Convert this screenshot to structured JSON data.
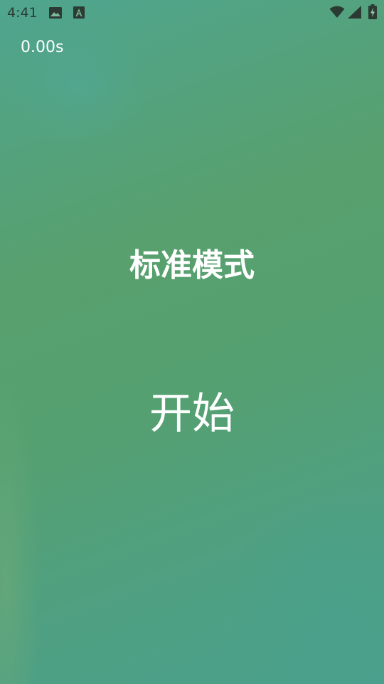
{
  "status_bar": {
    "time": "4:41",
    "notification_icons": [
      "image-icon",
      "font-a-icon"
    ],
    "system_icons": [
      "wifi-icon",
      "cell-signal-icon",
      "battery-charging-icon"
    ]
  },
  "game": {
    "timer": "0.00s",
    "mode_title": "标准模式",
    "start_label": "开始"
  },
  "colors": {
    "background_top": "#4fa58f",
    "background_mid": "#58a06e",
    "background_bottom": "#4aa08c",
    "text": "#ffffff",
    "status_icons": "#2b3b33"
  }
}
